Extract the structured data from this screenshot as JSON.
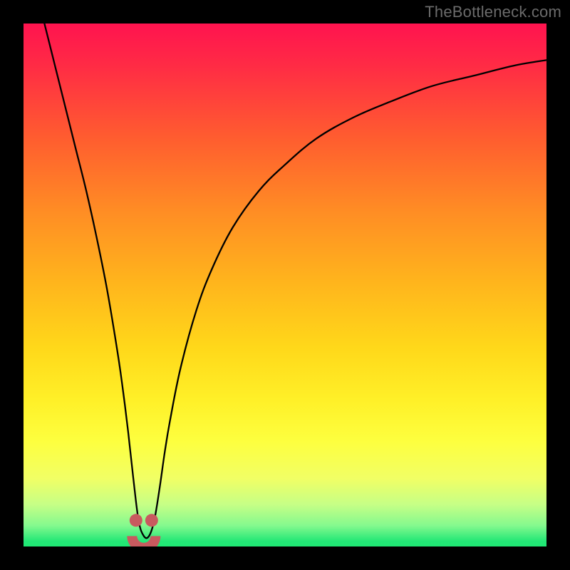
{
  "watermark": "TheBottleneck.com",
  "chart_data": {
    "type": "line",
    "title": "",
    "xlabel": "",
    "ylabel": "",
    "xlim": [
      0,
      100
    ],
    "ylim": [
      0,
      100
    ],
    "x_min_curve": 23,
    "series": [
      {
        "name": "bottleneck-curve",
        "x": [
          4,
          6,
          8,
          10,
          12,
          14,
          16,
          18,
          19,
          20,
          21,
          22,
          23,
          24,
          25,
          26,
          27,
          28,
          30,
          33,
          36,
          40,
          45,
          50,
          56,
          63,
          70,
          78,
          86,
          94,
          100
        ],
        "values": [
          100,
          92,
          84,
          76,
          68,
          59,
          49,
          37,
          30,
          22,
          13,
          5,
          2,
          2,
          5,
          11,
          18,
          24,
          34,
          45,
          53,
          61,
          68,
          73,
          78,
          82,
          85,
          88,
          90,
          92,
          93
        ]
      }
    ],
    "markers": {
      "x": [
        21.5,
        24.5
      ],
      "y": [
        5,
        5
      ],
      "color": "#c85a5f",
      "size": 9
    },
    "valley_arc": {
      "xc": 23,
      "yc": 2,
      "r_out": 3.2,
      "r_in": 1.3,
      "color": "#c85a5f"
    },
    "colors": {
      "curve": "#000000",
      "gradient_top": "#ff134f",
      "gradient_bottom": "#1fe874"
    }
  }
}
